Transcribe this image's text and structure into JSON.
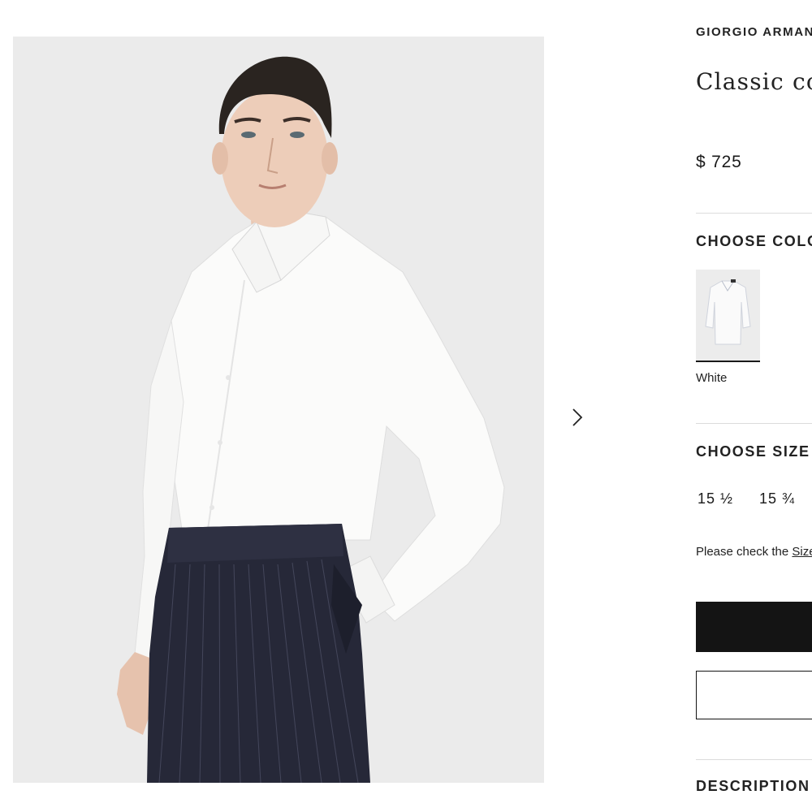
{
  "product": {
    "brand": "GIORGIO ARMANI",
    "title": "Classic collar shirt",
    "price": "$ 725"
  },
  "gallery": {
    "image_alt": "Model wearing white classic collar shirt with pinstripe trousers",
    "next_icon": "chevron-right-icon"
  },
  "color_section": {
    "heading": "CHOOSE COLOR",
    "selected_label": "White"
  },
  "size_section": {
    "heading": "CHOOSE SIZE",
    "options": [
      "15 ½",
      "15 ¾"
    ],
    "note_prefix": "Please check the ",
    "note_link": "Size Guide"
  },
  "description_section": {
    "heading": "DESCRIPTION"
  },
  "colors": {
    "accent": "#141414",
    "divider": "#dcdcdc",
    "image_bg": "#ebebeb"
  }
}
